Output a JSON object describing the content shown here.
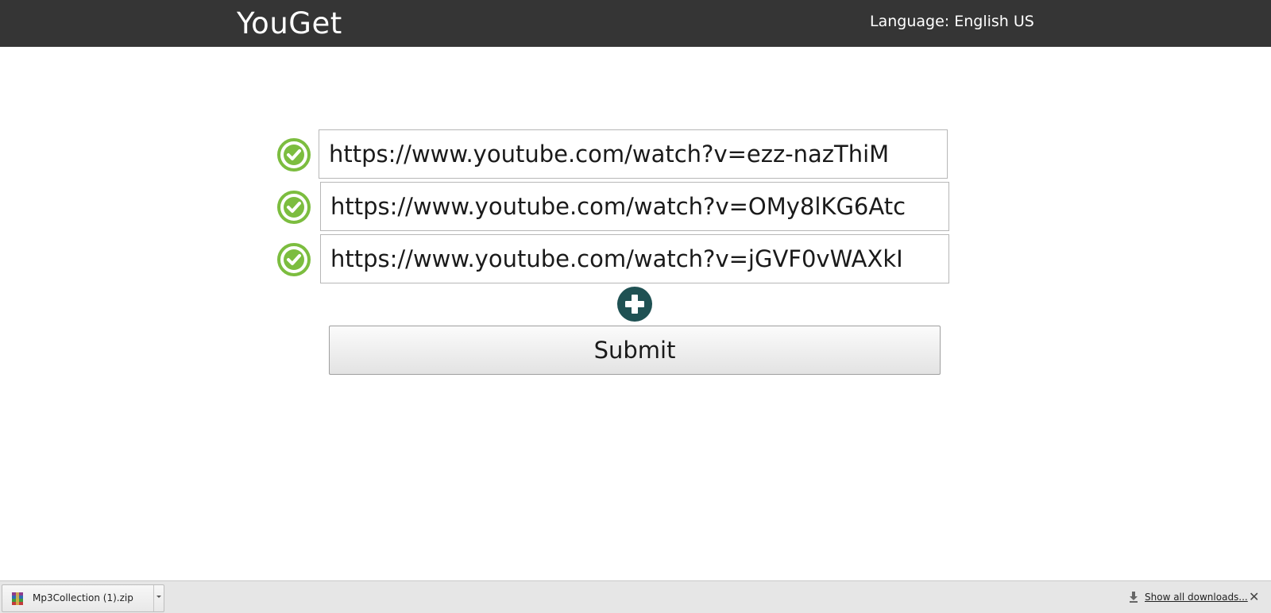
{
  "header": {
    "title": "YouGet",
    "language_label": "Language: English US"
  },
  "url_list": {
    "items": [
      {
        "value": "https://www.youtube.com/watch?v=ezz-nazThiM",
        "status": "valid",
        "status_icon": "check-circle-icon"
      },
      {
        "value": "https://www.youtube.com/watch?v=OMy8lKG6Atc",
        "status": "valid",
        "status_icon": "check-circle-icon"
      },
      {
        "value": "https://www.youtube.com/watch?v=jGVF0vWAXkI",
        "status": "valid",
        "status_icon": "check-circle-icon"
      }
    ],
    "add_icon": "plus-circle-icon"
  },
  "submit": {
    "label": "Submit"
  },
  "download_bar": {
    "file_name": "Mp3Collection (1).zip",
    "file_icon": "winrar-archive-icon",
    "show_all_label": "Show all downloads...",
    "close_glyph": "✕"
  },
  "colors": {
    "header_bg": "#353535",
    "check_green": "#7cbd3f",
    "add_button": "#1f5153"
  }
}
